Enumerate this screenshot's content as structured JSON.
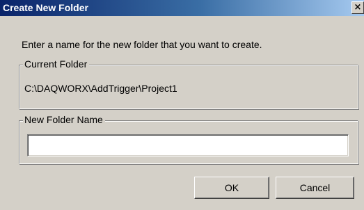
{
  "window": {
    "title": "Create New Folder",
    "close_symbol": "×"
  },
  "instruction": "Enter a name for the new folder that you want to create.",
  "current_folder": {
    "legend": "Current Folder",
    "path": "C:\\DAQWORX\\AddTrigger\\Project1"
  },
  "new_folder": {
    "legend": "New Folder Name",
    "value": ""
  },
  "buttons": {
    "ok": "OK",
    "cancel": "Cancel"
  },
  "colors": {
    "face": "#d4d0c8",
    "title_start": "#0a246a",
    "title_end": "#a6caf0"
  },
  "icons": {
    "close": "close-icon"
  }
}
